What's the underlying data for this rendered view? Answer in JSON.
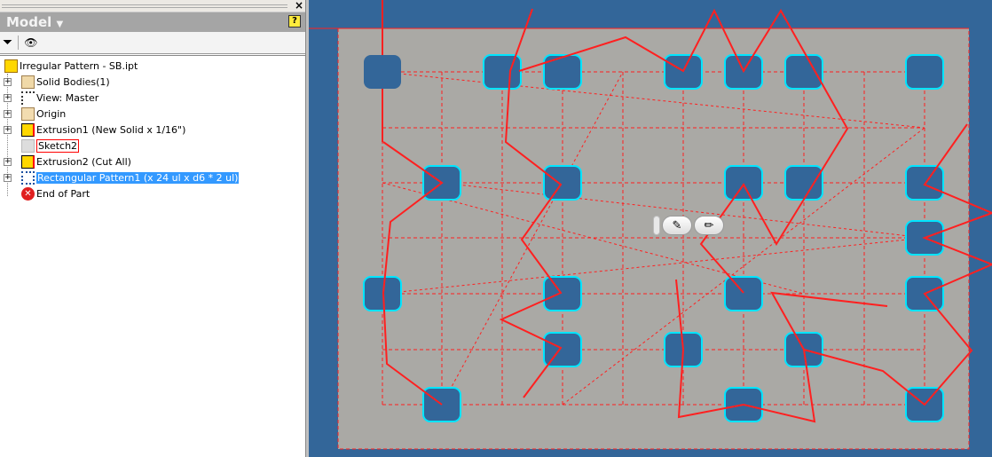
{
  "panel": {
    "title": "Model",
    "help_icon": "help-icon",
    "close_label": "×",
    "tree": [
      {
        "label": "Irregular Pattern - SB.ipt",
        "icon": "part-icon"
      },
      {
        "label": "Solid Bodies(1)",
        "icon": "solid-bodies-folder-icon"
      },
      {
        "label": "View: Master",
        "icon": "view-icon"
      },
      {
        "label": "Origin",
        "icon": "folder-icon"
      },
      {
        "label": "Extrusion1 (New Solid x 1/16\")",
        "icon": "extrusion-icon"
      },
      {
        "label": "Sketch2",
        "icon": "sketch-icon"
      },
      {
        "label": "Extrusion2 (Cut All)",
        "icon": "extrusion-icon"
      },
      {
        "label": "Rectangular Pattern1 (x 24 ul x d6 * 2 ul)",
        "icon": "rectangular-pattern-icon"
      },
      {
        "label": "End of Part",
        "icon": "end-of-part-icon"
      }
    ]
  },
  "colors": {
    "viewport": "#336699",
    "plate": "#aaa9a5",
    "sketch": "#ff2020",
    "highlight": "#00e5ff"
  }
}
